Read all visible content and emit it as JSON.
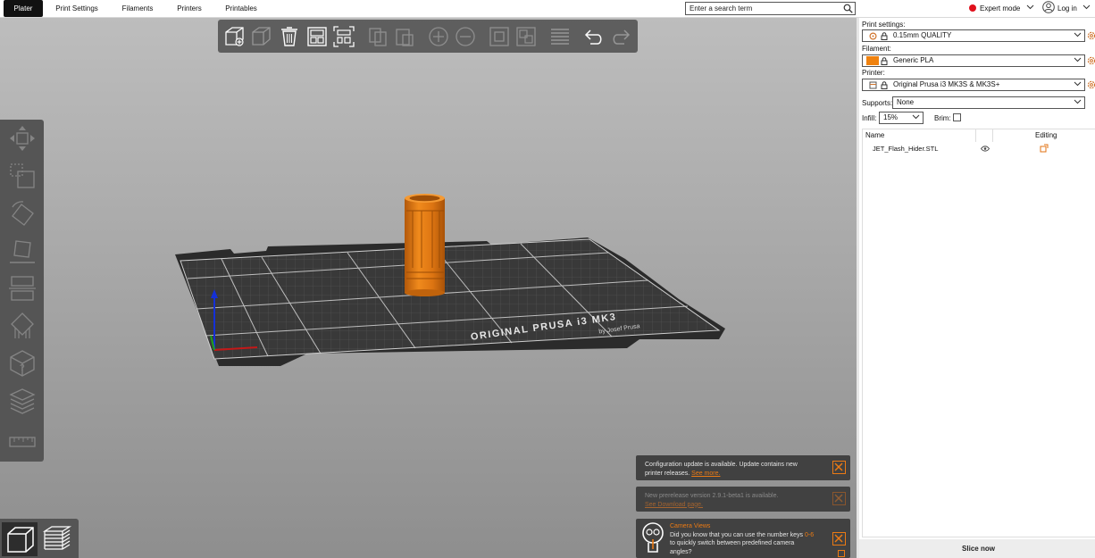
{
  "tabs": [
    {
      "label": "Plater",
      "active": true
    },
    {
      "label": "Print Settings",
      "active": false
    },
    {
      "label": "Filaments",
      "active": false
    },
    {
      "label": "Printers",
      "active": false
    },
    {
      "label": "Printables",
      "active": false
    }
  ],
  "search": {
    "placeholder": "Enter a search term"
  },
  "mode": {
    "label": "Expert mode",
    "color": "#e0101c"
  },
  "account": {
    "label": "Log in"
  },
  "bed": {
    "brand_text": "ORIGINAL PRUSA i3 MK3",
    "sub_text": "by Josef Prusa"
  },
  "sidebar": {
    "print_settings_label": "Print settings:",
    "print_settings_value": "0.15mm QUALITY",
    "filament_label": "Filament:",
    "filament_value": "Generic PLA",
    "filament_color": "#f0820f",
    "printer_label": "Printer:",
    "printer_value": "Original Prusa i3 MK3S & MK3S+",
    "supports_label": "Supports:",
    "supports_value": "None",
    "infill_label": "Infill:",
    "infill_value": "15%",
    "brim_label": "Brim:",
    "brim_checked": false
  },
  "object_list": {
    "columns": [
      "Name",
      "Editing"
    ],
    "items": [
      {
        "name": "JET_Flash_Hider.STL"
      }
    ]
  },
  "slice_button": {
    "label": "Slice now"
  },
  "notifications": {
    "config_update": {
      "text": "Configuration update is available. Update contains new printer releases.",
      "link": "See more."
    },
    "prerelease": {
      "text": "New prerelease version 2.9.1-beta1 is available.",
      "link": "See Download page."
    },
    "hint": {
      "title": "Camera Views",
      "text_pre": "Did you know that you can use the number keys",
      "keys": "0-6",
      "text_post": "to quickly switch between predefined camera angles?"
    }
  },
  "colors": {
    "accent": "#ee7a10",
    "object": "#e07b12",
    "bed": "#2a2a2a"
  }
}
